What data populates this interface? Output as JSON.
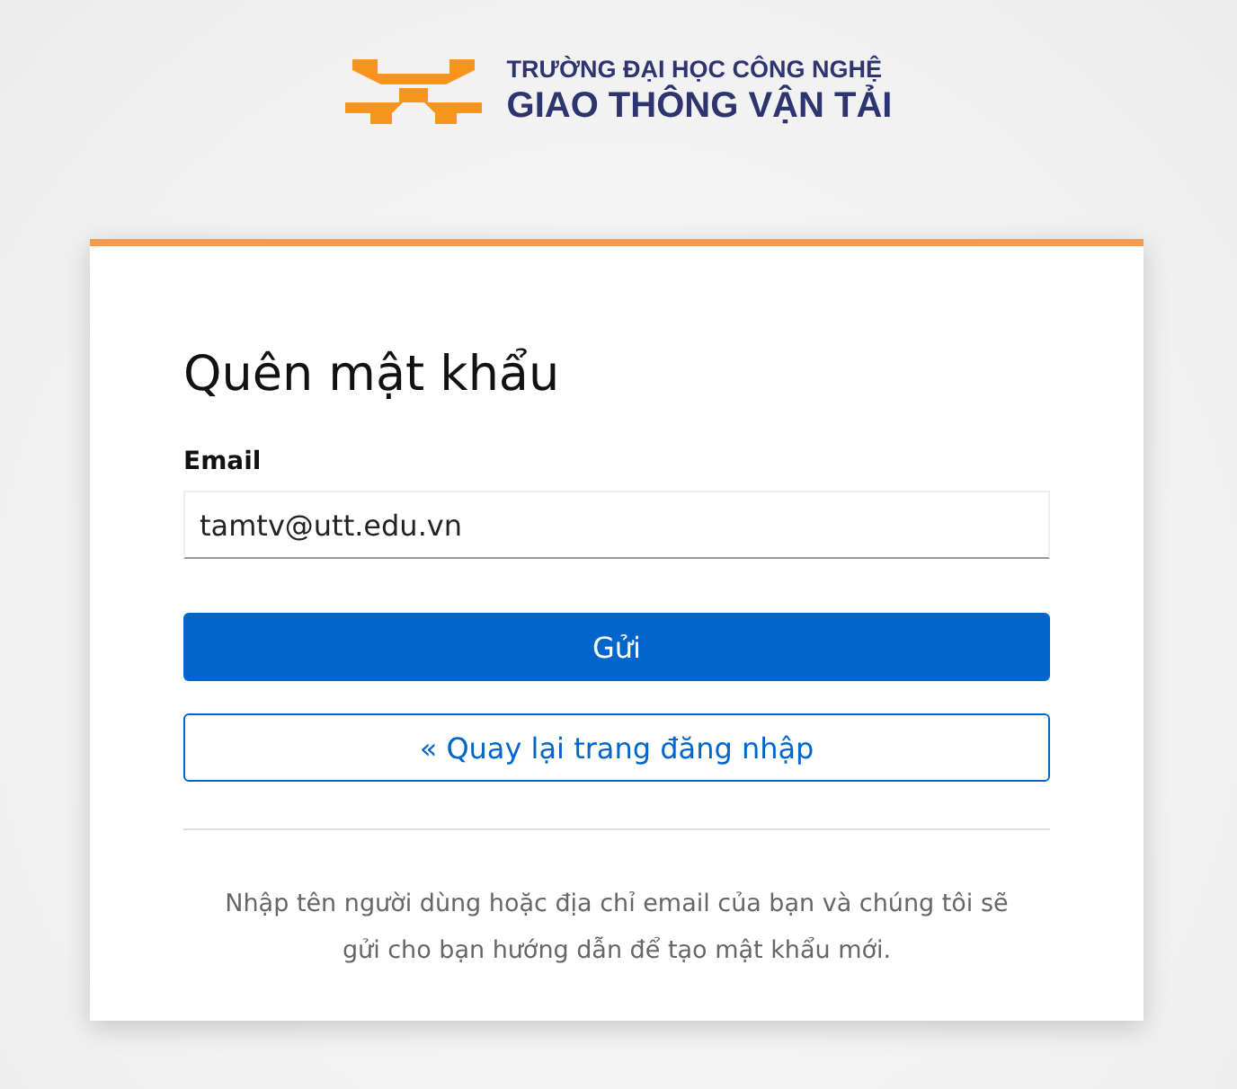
{
  "logo": {
    "line_1": "TRƯỜNG ĐẠI HỌC CÔNG NGHỆ",
    "line_2": "GIAO THÔNG VẬN TẢI"
  },
  "form": {
    "title": "Quên mật khẩu",
    "email_label": "Email",
    "email_value": "tamtv@utt.edu.vn",
    "submit": "Gửi",
    "back": "« Quay lại trang đăng nhập",
    "help": "Nhập tên người dùng hoặc địa chỉ email của bạn và chúng tôi sẽ gửi cho bạn hướng dẫn để tạo mật khẩu mới."
  }
}
